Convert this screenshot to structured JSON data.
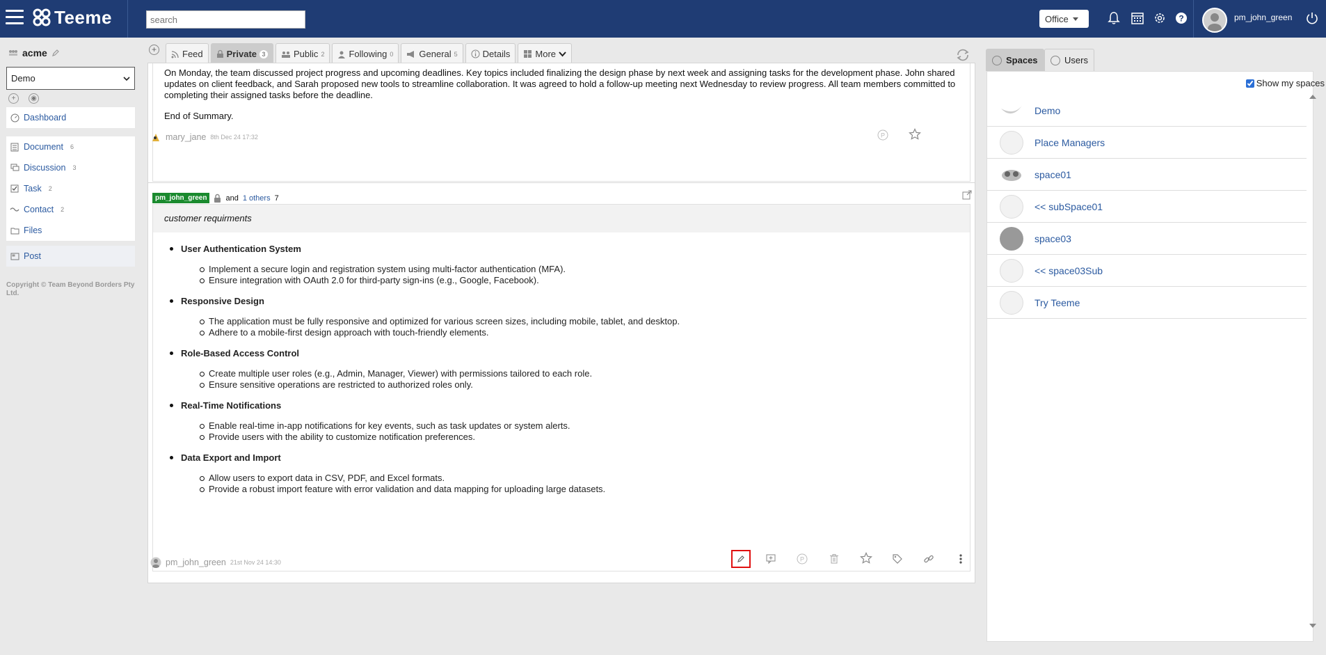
{
  "topbar": {
    "brand": "Teeme",
    "search_placeholder": "search",
    "office_label": "Office",
    "username": "pm_john_green",
    "icons": [
      "menu-icon",
      "bell-icon",
      "calendar-icon",
      "gear-icon",
      "help-icon",
      "power-icon"
    ]
  },
  "sidebar": {
    "space_name": "acme",
    "selected_space": "Demo",
    "items": [
      {
        "label": "Dashboard",
        "icon": "dashboard-icon",
        "count": ""
      },
      {
        "label": "Document",
        "icon": "document-icon",
        "count": "6"
      },
      {
        "label": "Discussion",
        "icon": "discussion-icon",
        "count": "3"
      },
      {
        "label": "Task",
        "icon": "task-icon",
        "count": "2"
      },
      {
        "label": "Contact",
        "icon": "contact-icon",
        "count": "2"
      },
      {
        "label": "Files",
        "icon": "folder-icon",
        "count": ""
      },
      {
        "label": "Post",
        "icon": "post-icon",
        "count": ""
      }
    ],
    "copyright": "Copyright © Team Beyond Borders Pty Ltd."
  },
  "tabs": [
    {
      "label": "Feed",
      "count": ""
    },
    {
      "label": "Private",
      "count": "3"
    },
    {
      "label": "Public",
      "count": "2"
    },
    {
      "label": "Following",
      "count": "0"
    },
    {
      "label": "General",
      "count": "5"
    },
    {
      "label": "Details",
      "count": ""
    },
    {
      "label": "More",
      "count": ""
    }
  ],
  "post1": {
    "text": "On Monday, the team discussed project progress and upcoming deadlines. Key topics included finalizing the design phase by next week and assigning tasks for the development phase. John shared updates on client feedback, and Sarah proposed new tools to streamline collaboration. It was agreed to hold a follow-up meeting next Wednesday to review progress. All team members committed to completing their assigned tasks before the deadline.",
    "end": "End of Summary.",
    "author": "mary_jane",
    "time": "8th Dec 24 17:32"
  },
  "post2": {
    "owner": "pm_john_green",
    "and": "and",
    "others": "1 others",
    "others_count": "7",
    "subject": "customer requirments",
    "sections": [
      {
        "title": "User Authentication System",
        "items": [
          "Implement a secure login and registration system using multi-factor authentication (MFA).",
          "Ensure integration with OAuth 2.0 for third-party sign-ins (e.g., Google, Facebook)."
        ]
      },
      {
        "title": "Responsive Design",
        "items": [
          "The application must be fully responsive and optimized for various screen sizes, including mobile, tablet, and desktop.",
          "Adhere to a mobile-first design approach with touch-friendly elements."
        ]
      },
      {
        "title": "Role-Based Access Control",
        "items": [
          "Create multiple user roles (e.g., Admin, Manager, Viewer) with permissions tailored to each role.",
          "Ensure sensitive operations are restricted to authorized roles only."
        ]
      },
      {
        "title": "Real-Time Notifications",
        "items": [
          "Enable real-time in-app notifications for key events, such as task updates or system alerts.",
          "Provide users with the ability to customize notification preferences."
        ]
      },
      {
        "title": "Data Export and Import",
        "items": [
          "Allow users to export data in CSV, PDF, and Excel formats.",
          "Provide a robust import feature with error validation and data mapping for uploading large datasets."
        ]
      }
    ],
    "author": "pm_john_green",
    "time": "21st Nov 24 14:30"
  },
  "right": {
    "tab_spaces": "Spaces",
    "tab_users": "Users",
    "show_my_spaces": "Show my spaces",
    "spaces": [
      "Demo",
      "Place Managers",
      "space01",
      "<< subSpace01",
      "space03",
      "<< space03Sub",
      "Try Teeme"
    ]
  },
  "colors": {
    "topbar": "#1f3c74",
    "accent_link": "#2b5aa0",
    "badge_green": "#1a8a2e",
    "highlight_red": "#e01010"
  }
}
